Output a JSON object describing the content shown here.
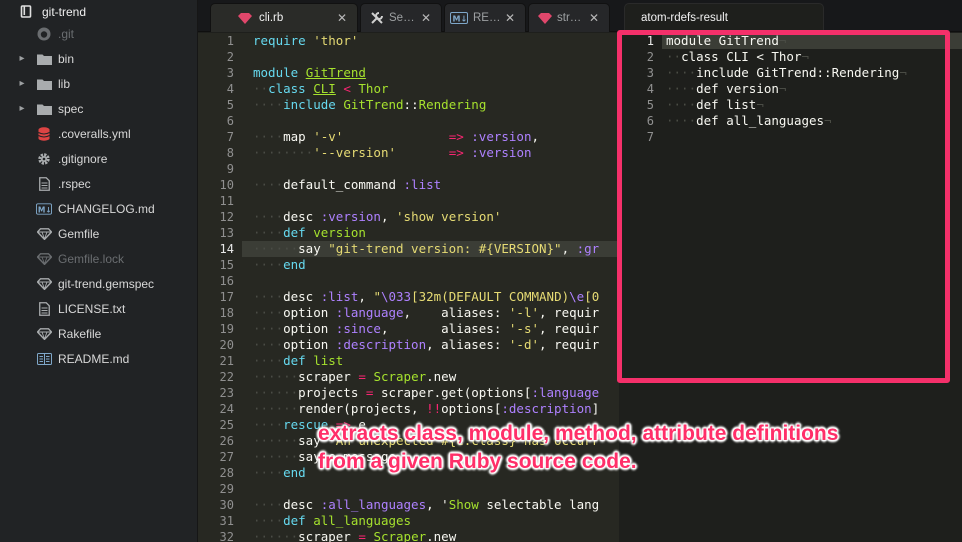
{
  "project": {
    "name": "git-trend"
  },
  "sidebar": {
    "items": [
      {
        "label": ".git",
        "icon": "github-icon",
        "dim": true,
        "expandable": false
      },
      {
        "label": "bin",
        "icon": "folder-icon",
        "dim": false,
        "expandable": true
      },
      {
        "label": "lib",
        "icon": "folder-icon",
        "dim": false,
        "expandable": true
      },
      {
        "label": "spec",
        "icon": "folder-icon",
        "dim": false,
        "expandable": true
      },
      {
        "label": ".coveralls.yml",
        "icon": "database-icon",
        "dim": false,
        "expandable": false
      },
      {
        "label": ".gitignore",
        "icon": "gear-icon",
        "dim": false,
        "expandable": false
      },
      {
        "label": ".rspec",
        "icon": "file-icon",
        "dim": false,
        "expandable": false
      },
      {
        "label": "CHANGELOG.md",
        "icon": "markdown-icon",
        "dim": false,
        "expandable": false
      },
      {
        "label": "Gemfile",
        "icon": "ruby-icon",
        "dim": false,
        "expandable": false
      },
      {
        "label": "Gemfile.lock",
        "icon": "ruby-icon",
        "dim": true,
        "expandable": false
      },
      {
        "label": "git-trend.gemspec",
        "icon": "ruby-icon",
        "dim": false,
        "expandable": false
      },
      {
        "label": "LICENSE.txt",
        "icon": "file-icon",
        "dim": false,
        "expandable": false
      },
      {
        "label": "Rakefile",
        "icon": "ruby-icon",
        "dim": false,
        "expandable": false
      },
      {
        "label": "README.md",
        "icon": "book-icon",
        "dim": false,
        "expandable": false
      }
    ]
  },
  "tabs": [
    {
      "label": "cli.rb",
      "icon": "ruby-icon",
      "active": true
    },
    {
      "label": "Se…",
      "icon": "tools-icon",
      "active": false
    },
    {
      "label": "RE…",
      "icon": "markdown-icon",
      "active": false
    },
    {
      "label": "str…",
      "icon": "ruby-icon",
      "active": false
    },
    {
      "label": "atom-rdefs-result",
      "icon": "",
      "active": true
    }
  ],
  "editor": {
    "current_line": 14,
    "lines": [
      "require 'thor'",
      "",
      "module GitTrend",
      "  class CLI < Thor",
      "    include GitTrend::Rendering",
      "",
      "    map '-v'              => :version,",
      "        '--version'       => :version",
      "",
      "    default_command :list",
      "",
      "    desc :version, 'show version'",
      "    def version",
      "      say \"git-trend version: #{VERSION}\", :gr",
      "    end",
      "",
      "    desc :list, \"\\033[32m(DEFAULT COMMAND)\\e[0",
      "    option :language,    aliases: '-l', requir",
      "    option :since,       aliases: '-s', requir",
      "    option :description, aliases: '-d', requir",
      "    def list",
      "      scraper = Scraper.new",
      "      projects = scraper.get(options[:language",
      "      render(projects, !!options[:description]",
      "    rescue => e",
      "      say \"An unexpected #{e.class} has occurr",
      "      say e.message",
      "    end",
      "",
      "    desc :all_languages, 'Show selectable lang",
      "    def all_languages",
      "      scraper = Scraper.new"
    ]
  },
  "result": {
    "current_line": 1,
    "lines": [
      "module GitTrend",
      "  class CLI < Thor",
      "    include GitTrend::Rendering",
      "    def version",
      "    def list",
      "    def all_languages",
      ""
    ]
  },
  "annotation": {
    "line1": "extracts class, module, method, attribute definitions",
    "line2": "from a given Ruby source code.",
    "color": "#f4306a"
  }
}
